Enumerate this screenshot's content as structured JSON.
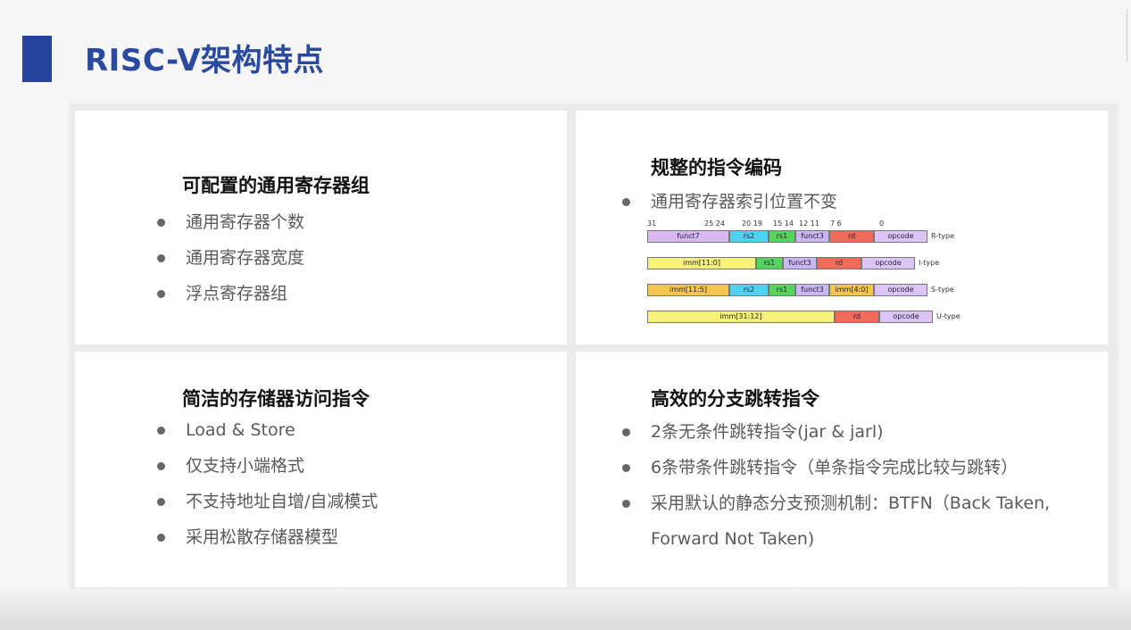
{
  "title": "RISC-V架构特点",
  "panels": [
    {
      "heading": "可配置的通用寄存器组",
      "items": [
        "通用寄存器个数",
        "通用寄存器宽度",
        "浮点寄存器组"
      ]
    },
    {
      "heading": "规整的指令编码",
      "items": [
        "通用寄存器索引位置不变"
      ]
    },
    {
      "heading": "简洁的存储器访问指令",
      "items": [
        "Load & Store",
        "仅支持小端格式",
        "不支持地址自增/自减模式",
        "采用松散存储器模型"
      ]
    },
    {
      "heading": "高效的分支跳转指令",
      "items": [
        "2条无条件跳转指令(jar & jarl)",
        "6条带条件跳转指令（单条指令完成比较与跳转）",
        "采用默认的静态分支预测机制：BTFN（Back Taken, Forward Not Taken)"
      ]
    }
  ],
  "formats": {
    "bit_labels": [
      "31",
      "25 24",
      "20 19",
      "15 14",
      "12 11",
      "7 6",
      "0"
    ],
    "rows": [
      {
        "type": "R-type",
        "fields": [
          {
            "label": "funct7",
            "color": "#d9b8f2"
          },
          {
            "label": "rs2",
            "color": "#4fd2ef"
          },
          {
            "label": "rs1",
            "color": "#55d35d"
          },
          {
            "label": "funct3",
            "color": "#c9b6f3"
          },
          {
            "label": "rd",
            "color": "#f26a5a"
          },
          {
            "label": "opcode",
            "color": "#dcc5f6"
          }
        ]
      },
      {
        "type": "I-type",
        "fields": [
          {
            "label": "imm[11:0]",
            "color": "#f7f07a"
          },
          {
            "label": "rs1",
            "color": "#55d35d"
          },
          {
            "label": "funct3",
            "color": "#c9b6f3"
          },
          {
            "label": "rd",
            "color": "#f26a5a"
          },
          {
            "label": "opcode",
            "color": "#dcc5f6"
          }
        ]
      },
      {
        "type": "S-type",
        "fields": [
          {
            "label": "imm[11:5]",
            "color": "#f2c64d"
          },
          {
            "label": "rs2",
            "color": "#4fd2ef"
          },
          {
            "label": "rs1",
            "color": "#55d35d"
          },
          {
            "label": "funct3",
            "color": "#c9b6f3"
          },
          {
            "label": "imm[4:0]",
            "color": "#f2c64d"
          },
          {
            "label": "opcode",
            "color": "#dcc5f6"
          }
        ]
      },
      {
        "type": "U-type",
        "fields": [
          {
            "label": "imm[31:12]",
            "color": "#f7f07a"
          },
          {
            "label": "rd",
            "color": "#f26a5a"
          },
          {
            "label": "opcode",
            "color": "#dcc5f6"
          }
        ]
      }
    ]
  }
}
